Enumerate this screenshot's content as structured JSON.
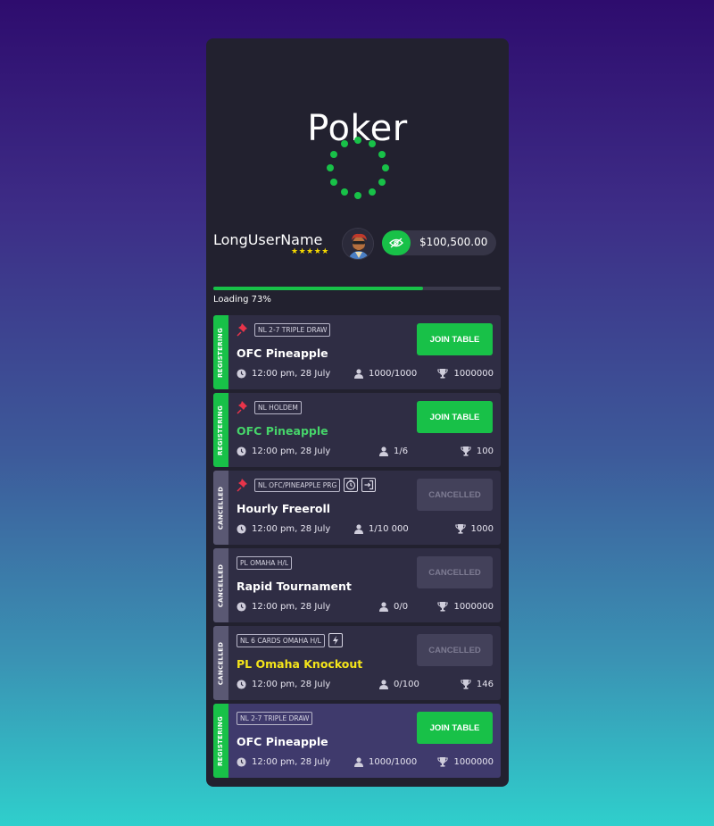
{
  "app": {
    "title": "Poker"
  },
  "user": {
    "name": "LongUserName",
    "stars": "★★★★★",
    "balance": "$100,500.00"
  },
  "loading": {
    "label": "Loading 73%",
    "fraction": 0.73
  },
  "colors": {
    "accent": "#18c148",
    "cancelled": "#5a5873",
    "panel": "#22212f"
  },
  "tournaments": [
    {
      "status": "REGISTERING",
      "status_type": "reg",
      "pinned": true,
      "tags": [
        "NL 2-7 TRIPLE DRAW"
      ],
      "extra_icons": [],
      "title": "OFC Pineapple",
      "title_color": "white",
      "time": "12:00 pm, 28 July",
      "players": "1000/1000",
      "prize": "1000000",
      "button": "JOIN TABLE",
      "button_type": "join",
      "highlight": false
    },
    {
      "status": "REGISTERING",
      "status_type": "reg",
      "pinned": true,
      "tags": [
        "NL HOLDEM"
      ],
      "extra_icons": [],
      "title": "OFC Pineapple",
      "title_color": "green",
      "time": "12:00 pm, 28 July",
      "players": "1/6",
      "prize": "100",
      "button": "JOIN TABLE",
      "button_type": "join",
      "highlight": false
    },
    {
      "status": "CANCELLED",
      "status_type": "can",
      "pinned": true,
      "tags": [
        "NL OFC/PINEAPPLE PRG"
      ],
      "extra_icons": [
        "timer-icon",
        "login-icon"
      ],
      "title": "Hourly Freeroll",
      "title_color": "white",
      "time": "12:00 pm, 28 July",
      "players": "1/10 000",
      "prize": "1000",
      "button": "CANCELLED",
      "button_type": "cancelled",
      "highlight": false
    },
    {
      "status": "CANCELLED",
      "status_type": "can",
      "pinned": false,
      "tags": [
        "PL OMAHA H/L"
      ],
      "extra_icons": [],
      "title": "Rapid Tournament",
      "title_color": "white",
      "time": "12:00 pm, 28 July",
      "players": "0/0",
      "prize": "1000000",
      "button": "CANCELLED",
      "button_type": "cancelled",
      "highlight": false
    },
    {
      "status": "CANCELLED",
      "status_type": "can",
      "pinned": false,
      "tags": [
        "NL 6 CARDS OMAHA H/L"
      ],
      "extra_icons": [
        "lightning-icon"
      ],
      "title": "PL Omaha Knockout",
      "title_color": "yellow",
      "time": "12:00 pm, 28 July",
      "players": "0/100",
      "prize": "146",
      "button": "CANCELLED",
      "button_type": "cancelled",
      "highlight": false
    },
    {
      "status": "REGISTERING",
      "status_type": "reg",
      "pinned": false,
      "tags": [
        "NL 2-7 TRIPLE DRAW"
      ],
      "extra_icons": [],
      "title": "OFC Pineapple",
      "title_color": "white",
      "time": "12:00 pm, 28 July",
      "players": "1000/1000",
      "prize": "1000000",
      "button": "JOIN TABLE",
      "button_type": "join",
      "highlight": true
    }
  ]
}
